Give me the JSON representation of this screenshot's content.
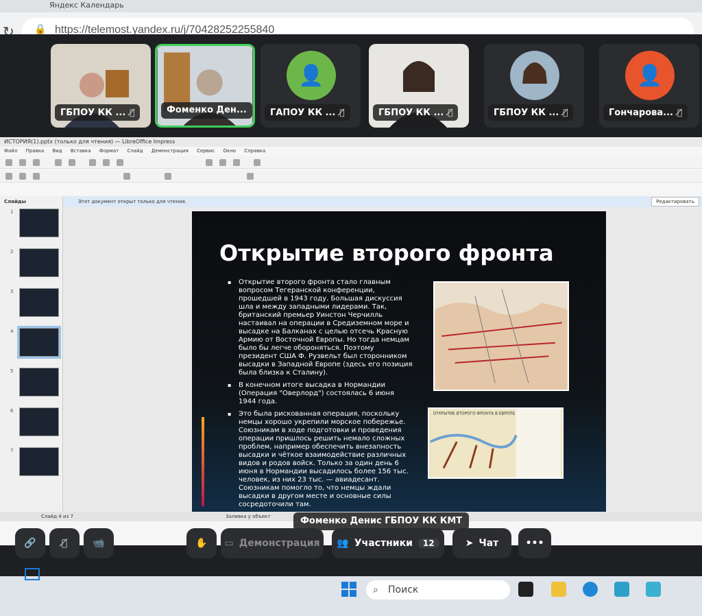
{
  "browser": {
    "tab_title": "Яндекс Календарь",
    "url": "https://telemost.yandex.ru/j/70428252255840"
  },
  "participants": [
    {
      "label": "ГБПОУ КК ..."
    },
    {
      "label": "Фоменко Ден..."
    },
    {
      "label": "ГАПОУ КК ..."
    },
    {
      "label": "ГБПОУ КК ..."
    },
    {
      "label": "ГБПОУ КК ..."
    },
    {
      "label": "Гончарова..."
    }
  ],
  "impress": {
    "title": "ИСТОРИЯ(1).pptx (только для чтения) — LibreOffice Impress",
    "menu": [
      "Файл",
      "Правка",
      "Вид",
      "Вставка",
      "Формат",
      "Слайд",
      "Демонстрация",
      "Сервис",
      "Окно",
      "Справка"
    ],
    "readonly_notice": "Этот документ открыт только для чтения.",
    "edit_button": "Редактировать",
    "panel_title": "Слайды",
    "status_left": "Слайд 4 из 7",
    "status_mid": "Заливка у объект"
  },
  "slide": {
    "title": "Открытие второго фронта",
    "bullets": [
      "Открытие второго фронта стало главным вопросом Тегеранской конференции, прошедшей в 1943 году. Большая дискуссия шла и между западными лидерами. Так, британский премьер Уинстон Черчилль настаивал на операции в Средиземном море и высадке на Балканах с целью отсечь Красную Армию от Восточной Европы. Но тогда немцам было бы легче обороняться. Поэтому президент США Ф. Рузвельт был сторонником высадки в Западной Европе (здесь его позиция была близка к Сталину).",
      "В конечном итоге высадка в Нормандии (Операция \"Оверлорд\") состоялась 6 июня 1944 года.",
      "Это была рискованная операция, поскольку немцы хорошо укрепили морское побережье. Союзникам в ходе подготовки и проведения операции пришлось решить немало сложных проблем, например обеспечить внезапность высадки и чёткое взаимодействие различных видов и родов войск. Только за один день 6 июня в Нормандии высадилось более 156 тыс. человек, из них 23 тыс. — авиадесант. Союзникам помогло то, что немцы ждали высадки в другом месте и основные силы сосредоточили там."
    ],
    "map2_caption": "ОТКРЫТИЕ ВТОРОГО ФРОНТА В ЕВРОПЕ"
  },
  "presenter_label": "Фоменко Денис ГБПОУ КК КМТ",
  "controls": {
    "demo": "Демонстрация",
    "participants": "Участники",
    "participants_count": "12",
    "chat": "Чат",
    "more": "•••"
  },
  "taskbar": {
    "search_placeholder": "Поиск"
  },
  "colors": {
    "active_speaker": "#3fcf5a",
    "avatar_green": "#6db74a",
    "avatar_orange": "#e8542c"
  }
}
